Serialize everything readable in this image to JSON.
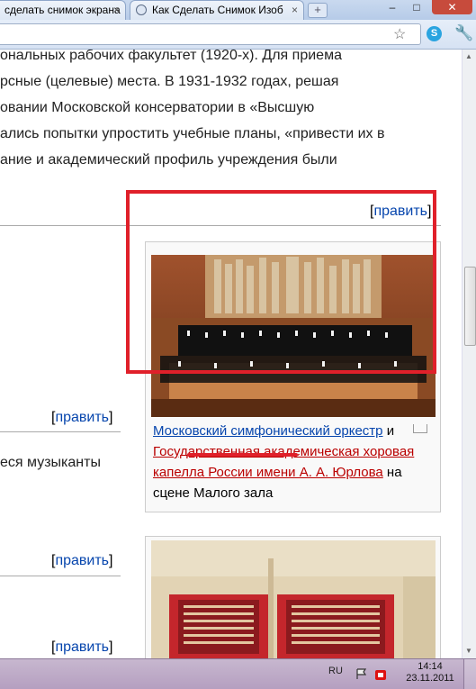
{
  "browser": {
    "tabs": [
      {
        "label": "сделать снимок экрана"
      },
      {
        "label": "Как Сделать Снимок Изоб"
      }
    ],
    "close_symbol": "×",
    "new_tab_symbol": "+",
    "window_controls": {
      "minimize": "–",
      "maximize": "□",
      "close": "✕"
    },
    "icons": {
      "star": "☆",
      "skype": "S",
      "wrench": "🔧"
    }
  },
  "article": {
    "paragraph_lines": [
      "ональных рабочих факультет (1920-х). Для приема",
      "рсные (целевые) места. В 1931-1932 годах, решая",
      "овании Московской консерватории в «Высшую",
      "ались попытки упростить учебные планы, «привести их в",
      "ание и академический профиль учреждения были"
    ],
    "edit_link": "править",
    "edit_open": "[",
    "edit_close": "]",
    "side_text": "еся музыканты",
    "caption": {
      "link1": "Московский симфонический оркестр",
      "and": " и ",
      "link2": "Государственная академическая хоровая капелла России имени А. А. Юрлова",
      "on_stage": " на сцене ",
      "link3": "Малого зала"
    }
  },
  "taskbar": {
    "language": "RU",
    "time": "14:14",
    "date": "23.11.2011"
  },
  "colors": {
    "annotation_red": "#e0202a",
    "link_blue": "#0645ad",
    "redlink": "#ba0000"
  }
}
